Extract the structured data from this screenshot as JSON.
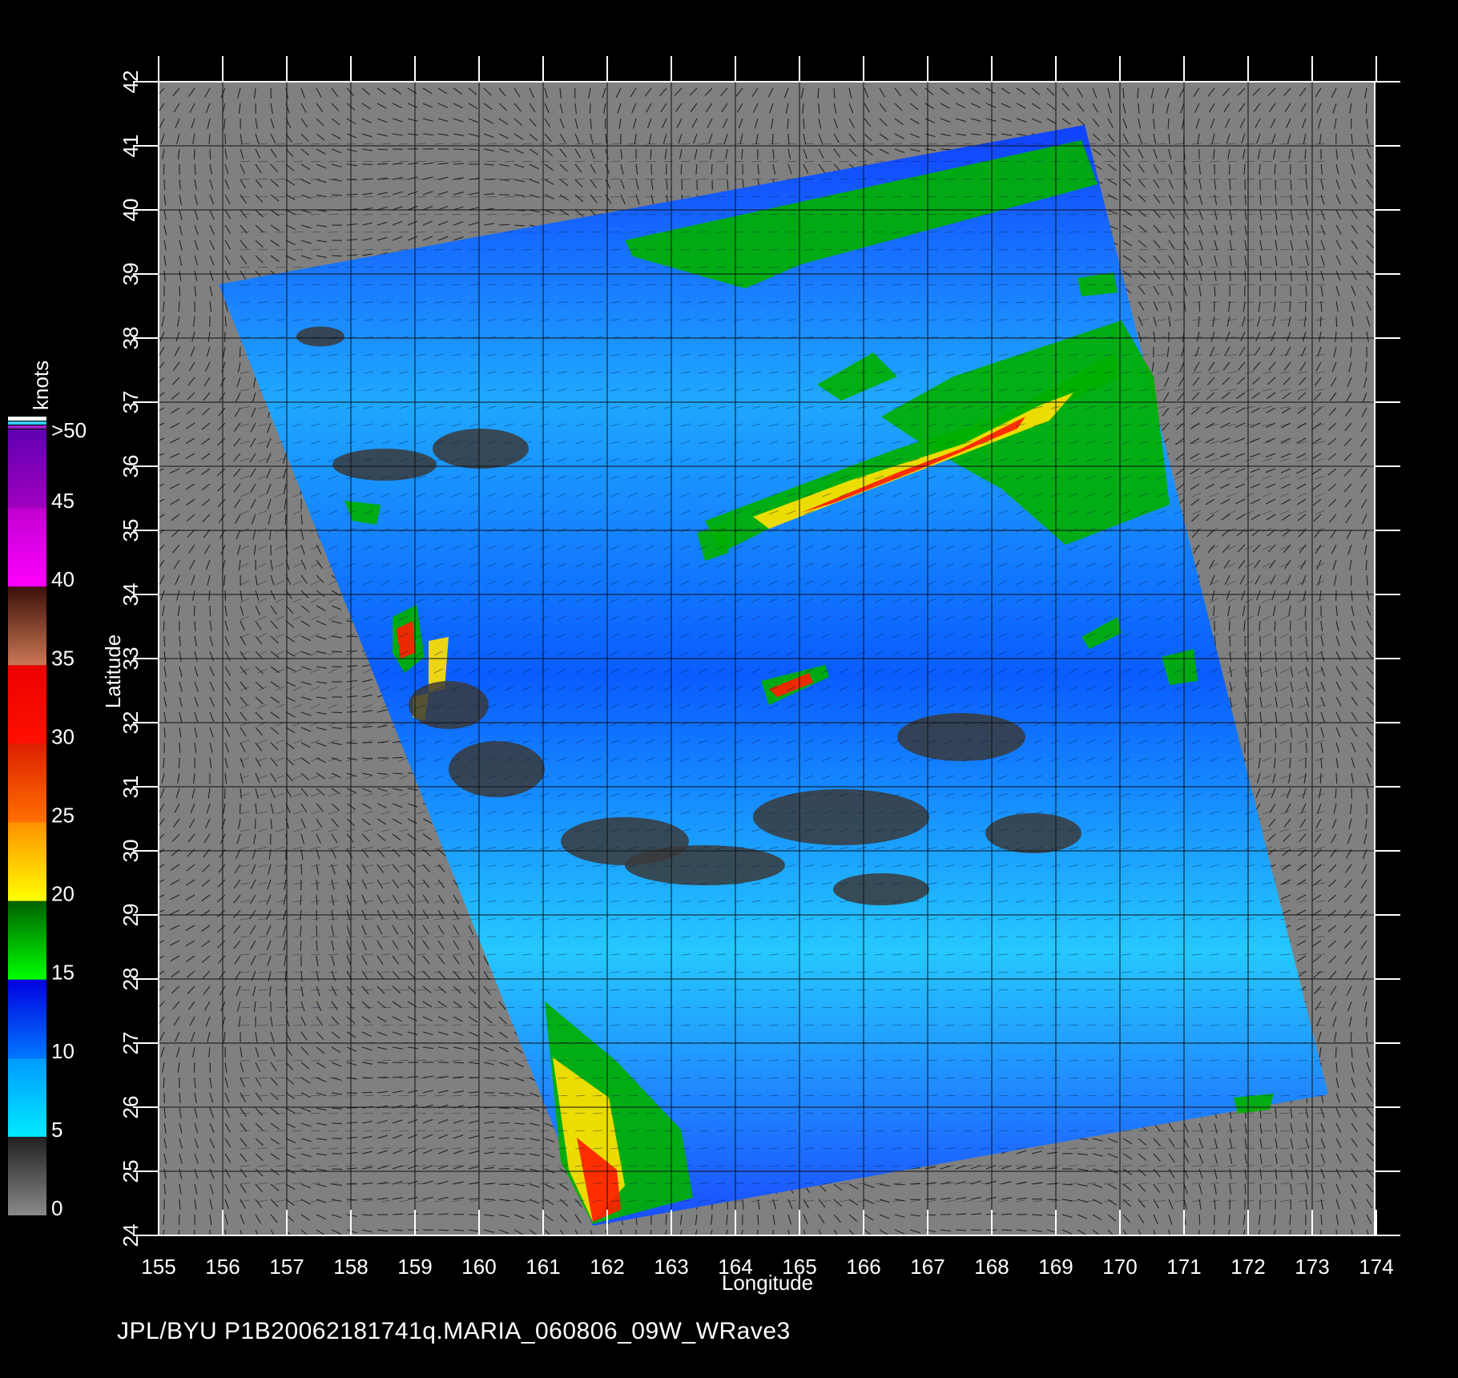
{
  "map": {
    "x_axis": {
      "label": "Longitude",
      "ticks": [
        "155",
        "156",
        "157",
        "158",
        "159",
        "160",
        "161",
        "162",
        "163",
        "164",
        "165",
        "166",
        "167",
        "168",
        "169",
        "170",
        "171",
        "172",
        "173",
        "174"
      ]
    },
    "y_axis": {
      "label": "Latitude",
      "ticks": [
        "24",
        "25",
        "26",
        "27",
        "28",
        "29",
        "30",
        "31",
        "32",
        "33",
        "34",
        "35",
        "36",
        "37",
        "38",
        "39",
        "40",
        "41",
        "42"
      ]
    },
    "background_color": "#808080",
    "swath_colors": [
      "#00e5ff",
      "#0a5cff",
      "#00b000",
      "#ffe000",
      "#ff2000"
    ]
  },
  "colorbar": {
    "unit": "knots",
    "labels": [
      "0",
      "5",
      "10",
      "15",
      "20",
      "25",
      "30",
      "35",
      "40",
      "45",
      ">50"
    ],
    "segments": [
      {
        "from": 0,
        "to": 5,
        "colors": [
          "#8a8a8a",
          "#202020"
        ]
      },
      {
        "from": 5,
        "to": 10,
        "colors": [
          "#00eaff",
          "#0099ff"
        ]
      },
      {
        "from": 10,
        "to": 15,
        "colors": [
          "#0077ff",
          "#0000e0"
        ]
      },
      {
        "from": 15,
        "to": 20,
        "colors": [
          "#00ff00",
          "#006000"
        ]
      },
      {
        "from": 20,
        "to": 25,
        "colors": [
          "#ffff00",
          "#ff9000"
        ]
      },
      {
        "from": 25,
        "to": 30,
        "colors": [
          "#ff7000",
          "#dd2000"
        ]
      },
      {
        "from": 30,
        "to": 35,
        "colors": [
          "#ff1000",
          "#ee0000"
        ]
      },
      {
        "from": 35,
        "to": 40,
        "colors": [
          "#cc7755",
          "#3a1008"
        ]
      },
      {
        "from": 40,
        "to": 45,
        "colors": [
          "#ff00ff",
          "#c000d0"
        ]
      },
      {
        "from": 45,
        "to": 50,
        "colors": [
          "#a000c0",
          "#6000b0"
        ]
      }
    ]
  },
  "footer": "JPL/BYU  P1B20062181741q.MARIA_060806_09W_WRave3"
}
